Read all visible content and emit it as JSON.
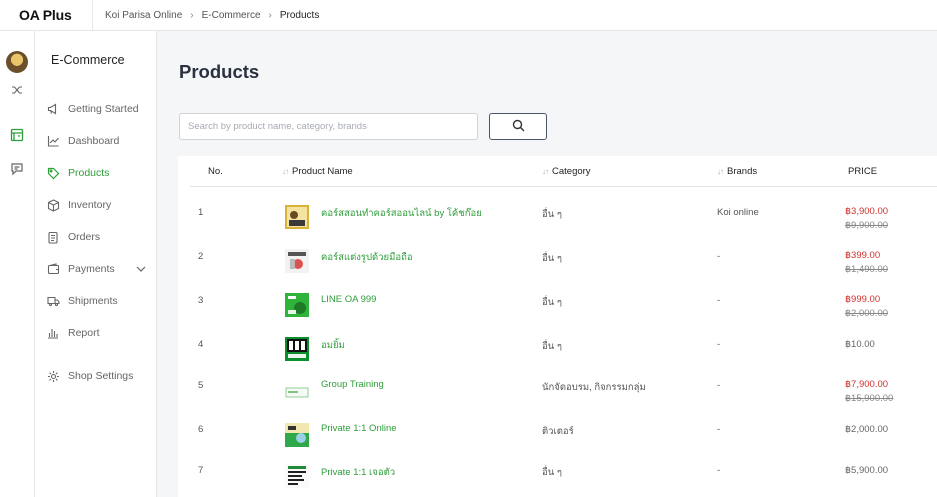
{
  "app": {
    "name": "OA Plus"
  },
  "breadcrumb": [
    "Koi Parisa Online",
    "E-Commerce",
    "Products"
  ],
  "sidebar": {
    "title": "E-Commerce",
    "items": [
      {
        "label": "Getting Started",
        "icon": "megaphone-icon"
      },
      {
        "label": "Dashboard",
        "icon": "chart-line-icon"
      },
      {
        "label": "Products",
        "icon": "tag-icon",
        "active": true
      },
      {
        "label": "Inventory",
        "icon": "box-icon"
      },
      {
        "label": "Orders",
        "icon": "clipboard-icon"
      },
      {
        "label": "Payments",
        "icon": "wallet-icon",
        "has_chevron": true
      },
      {
        "label": "Shipments",
        "icon": "truck-icon"
      },
      {
        "label": "Report",
        "icon": "bar-chart-icon"
      },
      {
        "label": "Shop Settings",
        "icon": "gear-icon"
      }
    ]
  },
  "main": {
    "title": "Products",
    "search": {
      "placeholder": "Search by product name, category, brands",
      "value": ""
    }
  },
  "table": {
    "headers": {
      "no": "No.",
      "name": "Product Name",
      "category": "Category",
      "brands": "Brands",
      "price": "PRICE"
    },
    "rows": [
      {
        "no": "1",
        "name": "คอร์สสอนทำคอร์สออนไลน์ by โค้ชก๊อย",
        "category": "อื่น ๆ",
        "brand": "Koi online",
        "price": "฿3,900.00",
        "old_price": "฿9,900.00",
        "thumb": "photo"
      },
      {
        "no": "2",
        "name": "คอร์สแต่งรูปด้วยมือถือ",
        "category": "อื่น ๆ",
        "brand": "-",
        "price": "฿399.00",
        "old_price": "฿1,490.00",
        "thumb": "phone"
      },
      {
        "no": "3",
        "name": "LINE OA 999",
        "category": "อื่น ๆ",
        "brand": "-",
        "price": "฿999.00",
        "old_price": "฿2,000.00",
        "thumb": "green"
      },
      {
        "no": "4",
        "name": "อมยิ้ม",
        "category": "อื่น ๆ",
        "brand": "-",
        "price": "฿10.00",
        "old_price": "",
        "thumb": "koi"
      },
      {
        "no": "5",
        "name": "Group Training",
        "category": "นักจัดอบรม, กิจกรรมกลุ่ม",
        "brand": "-",
        "price": "฿7,900.00",
        "old_price": "฿15,900.00",
        "thumb": "light"
      },
      {
        "no": "6",
        "name": "Private 1:1 Online",
        "category": "ติวเตอร์",
        "brand": "-",
        "price": "฿2,000.00",
        "old_price": "",
        "thumb": "mixed"
      },
      {
        "no": "7",
        "name": "Private 1:1 เจอตัว",
        "category": "อื่น ๆ",
        "brand": "-",
        "price": "฿5,900.00",
        "old_price": "",
        "thumb": "text"
      }
    ]
  },
  "colors": {
    "accent": "#2e9e3a",
    "sale": "#d0312d"
  }
}
